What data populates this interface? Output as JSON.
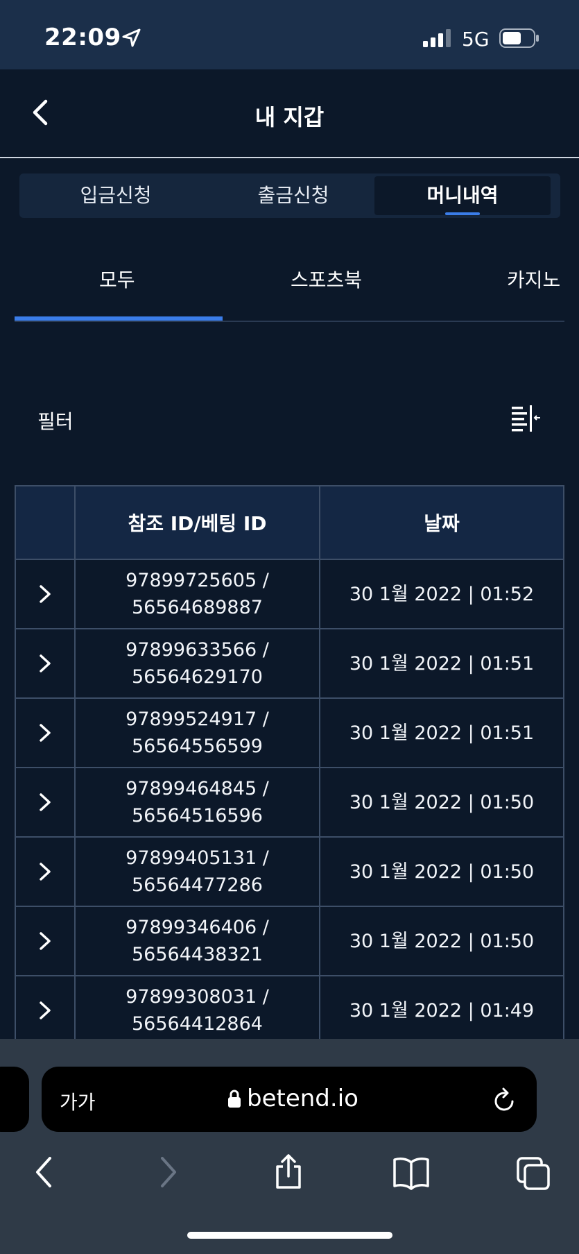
{
  "status_bar": {
    "time": "22:09",
    "network": "5G"
  },
  "header": {
    "title": "내 지갑"
  },
  "segment_tabs": [
    {
      "label": "입금신청",
      "active": false
    },
    {
      "label": "출금신청",
      "active": false
    },
    {
      "label": "머니내역",
      "active": true
    }
  ],
  "sub_tabs": [
    {
      "label": "모두",
      "active": true
    },
    {
      "label": "스포츠북",
      "active": false
    },
    {
      "label": "카지노",
      "active": false
    }
  ],
  "filter": {
    "label": "필터",
    "icon": "filter-list-icon"
  },
  "table": {
    "headers": [
      "",
      "참조 ID/베팅 ID",
      "날짜"
    ],
    "rows": [
      {
        "ref_id": "97899725605 /",
        "bet_id": "56564689887",
        "date": "30 1월 2022 | 01:52"
      },
      {
        "ref_id": "97899633566 /",
        "bet_id": "56564629170",
        "date": "30 1월 2022 | 01:51"
      },
      {
        "ref_id": "97899524917 /",
        "bet_id": "56564556599",
        "date": "30 1월 2022 | 01:51"
      },
      {
        "ref_id": "97899464845 /",
        "bet_id": "56564516596",
        "date": "30 1월 2022 | 01:50"
      },
      {
        "ref_id": "97899405131 /",
        "bet_id": "56564477286",
        "date": "30 1월 2022 | 01:50"
      },
      {
        "ref_id": "97899346406 /",
        "bet_id": "56564438321",
        "date": "30 1월 2022 | 01:50"
      },
      {
        "ref_id": "97899308031 /",
        "bet_id": "56564412864",
        "date": "30 1월 2022 | 01:49"
      }
    ]
  },
  "browser": {
    "text_size_label": "가가",
    "domain": "betend.io"
  },
  "colors": {
    "background": "#0c1829",
    "accent": "#3b7de9",
    "status_bar": "#1b2f4a",
    "table_header": "#142744"
  }
}
